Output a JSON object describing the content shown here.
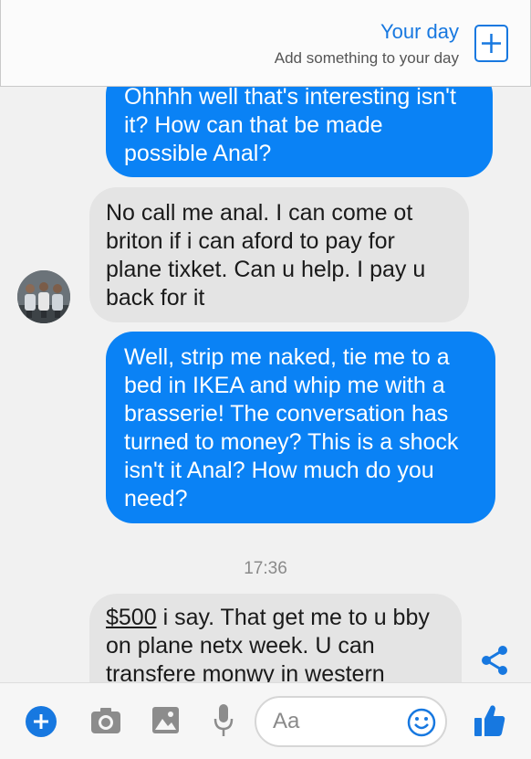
{
  "your_day": {
    "title": "Your day",
    "subtitle": "Add something to your day"
  },
  "messages": [
    {
      "direction": "outgoing",
      "lines": [
        "Ohhhh well that's interesting isn't",
        "it? How can that be made",
        "possible Anal?"
      ]
    },
    {
      "direction": "incoming",
      "lines": [
        "No call me anal. I can come ot",
        "briton if i can aford to pay for",
        "plane tixket. Can u help. I pay u",
        "back for it"
      ]
    },
    {
      "direction": "outgoing",
      "lines": [
        "Well, strip me naked, tie me to a",
        "bed in IKEA and whip me with a",
        "brasserie! The conversation has",
        "turned to money? This is a shock",
        "isn't it Anal? How much do you",
        "need?"
      ]
    },
    {
      "direction": "incoming",
      "amount": "$500",
      "first_line_rest": " i say. That get me to u bby",
      "lines": [
        "on plane netx week. U can",
        "transfere monwy in western"
      ]
    }
  ],
  "timestamp": "17:36",
  "composer": {
    "placeholder": "Aa"
  },
  "icons": [
    "plus-icon",
    "camera-icon",
    "image-icon",
    "microphone-icon",
    "emoji-icon",
    "thumbs-up-icon",
    "share-icon"
  ],
  "colors": {
    "outgoing_bubble": "#0a82f5",
    "incoming_bubble": "#e4e4e4",
    "accent": "#1778e0"
  }
}
